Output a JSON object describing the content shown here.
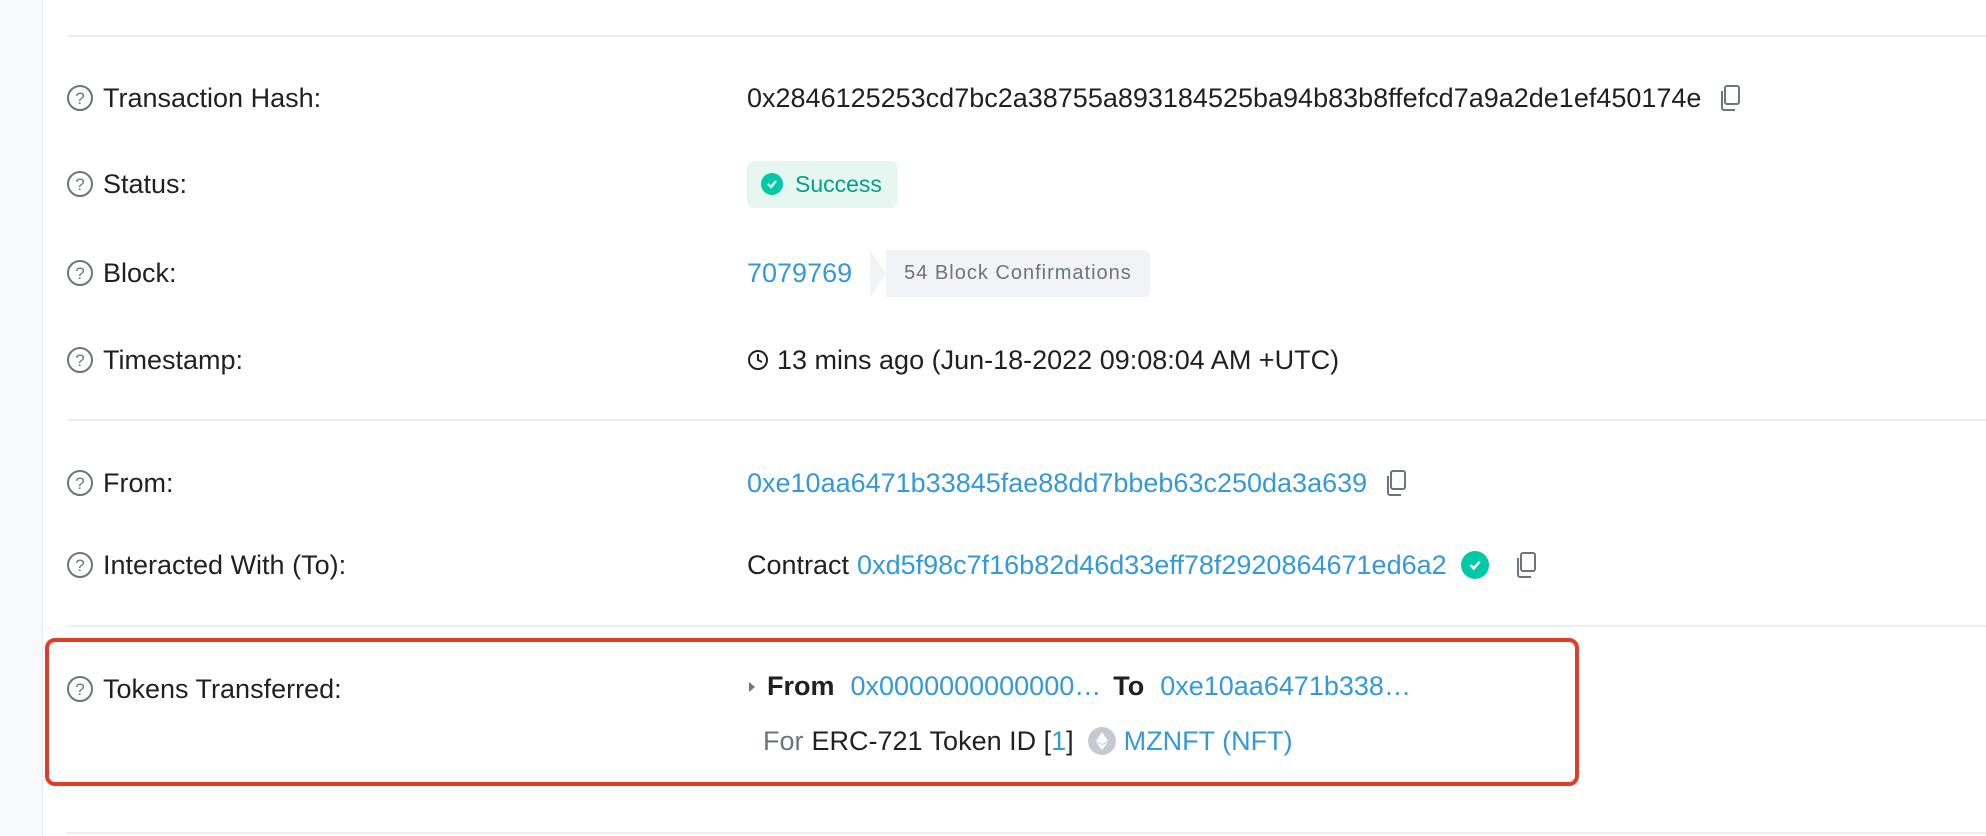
{
  "rows": {
    "tx_hash": {
      "label": "Transaction Hash:",
      "value": "0x2846125253cd7bc2a38755a893184525ba94b83b8ffefcd7a9a2de1ef450174e"
    },
    "status": {
      "label": "Status:",
      "value": "Success"
    },
    "block": {
      "label": "Block:",
      "number": "7079769",
      "confirmations": "54 Block Confirmations"
    },
    "timestamp": {
      "label": "Timestamp:",
      "value": "13 mins ago (Jun-18-2022 09:08:04 AM +UTC)"
    },
    "from": {
      "label": "From:",
      "value": "0xe10aa6471b33845fae88dd7bbeb63c250da3a639"
    },
    "to": {
      "label": "Interacted With (To):",
      "prefix": "Contract",
      "value": "0xd5f98c7f16b82d46d33eff78f2920864671ed6a2"
    },
    "tokens": {
      "label": "Tokens Transferred:",
      "from_label": "From",
      "from_value": "0x0000000000000…",
      "to_label": "To",
      "to_value": "0xe10aa6471b338…",
      "for_label": "For",
      "token_type": "ERC-721 Token ID [",
      "token_id": "1",
      "token_close": "]",
      "token_name": "MZNFT (NFT)"
    }
  },
  "colors": {
    "link": "#3498db",
    "success": "#00c9a7",
    "highlight": "#e23b2b"
  },
  "icons": [
    "question-icon",
    "copy-icon",
    "check-circle-icon",
    "clock-icon",
    "caret-right-icon",
    "eth-icon"
  ]
}
